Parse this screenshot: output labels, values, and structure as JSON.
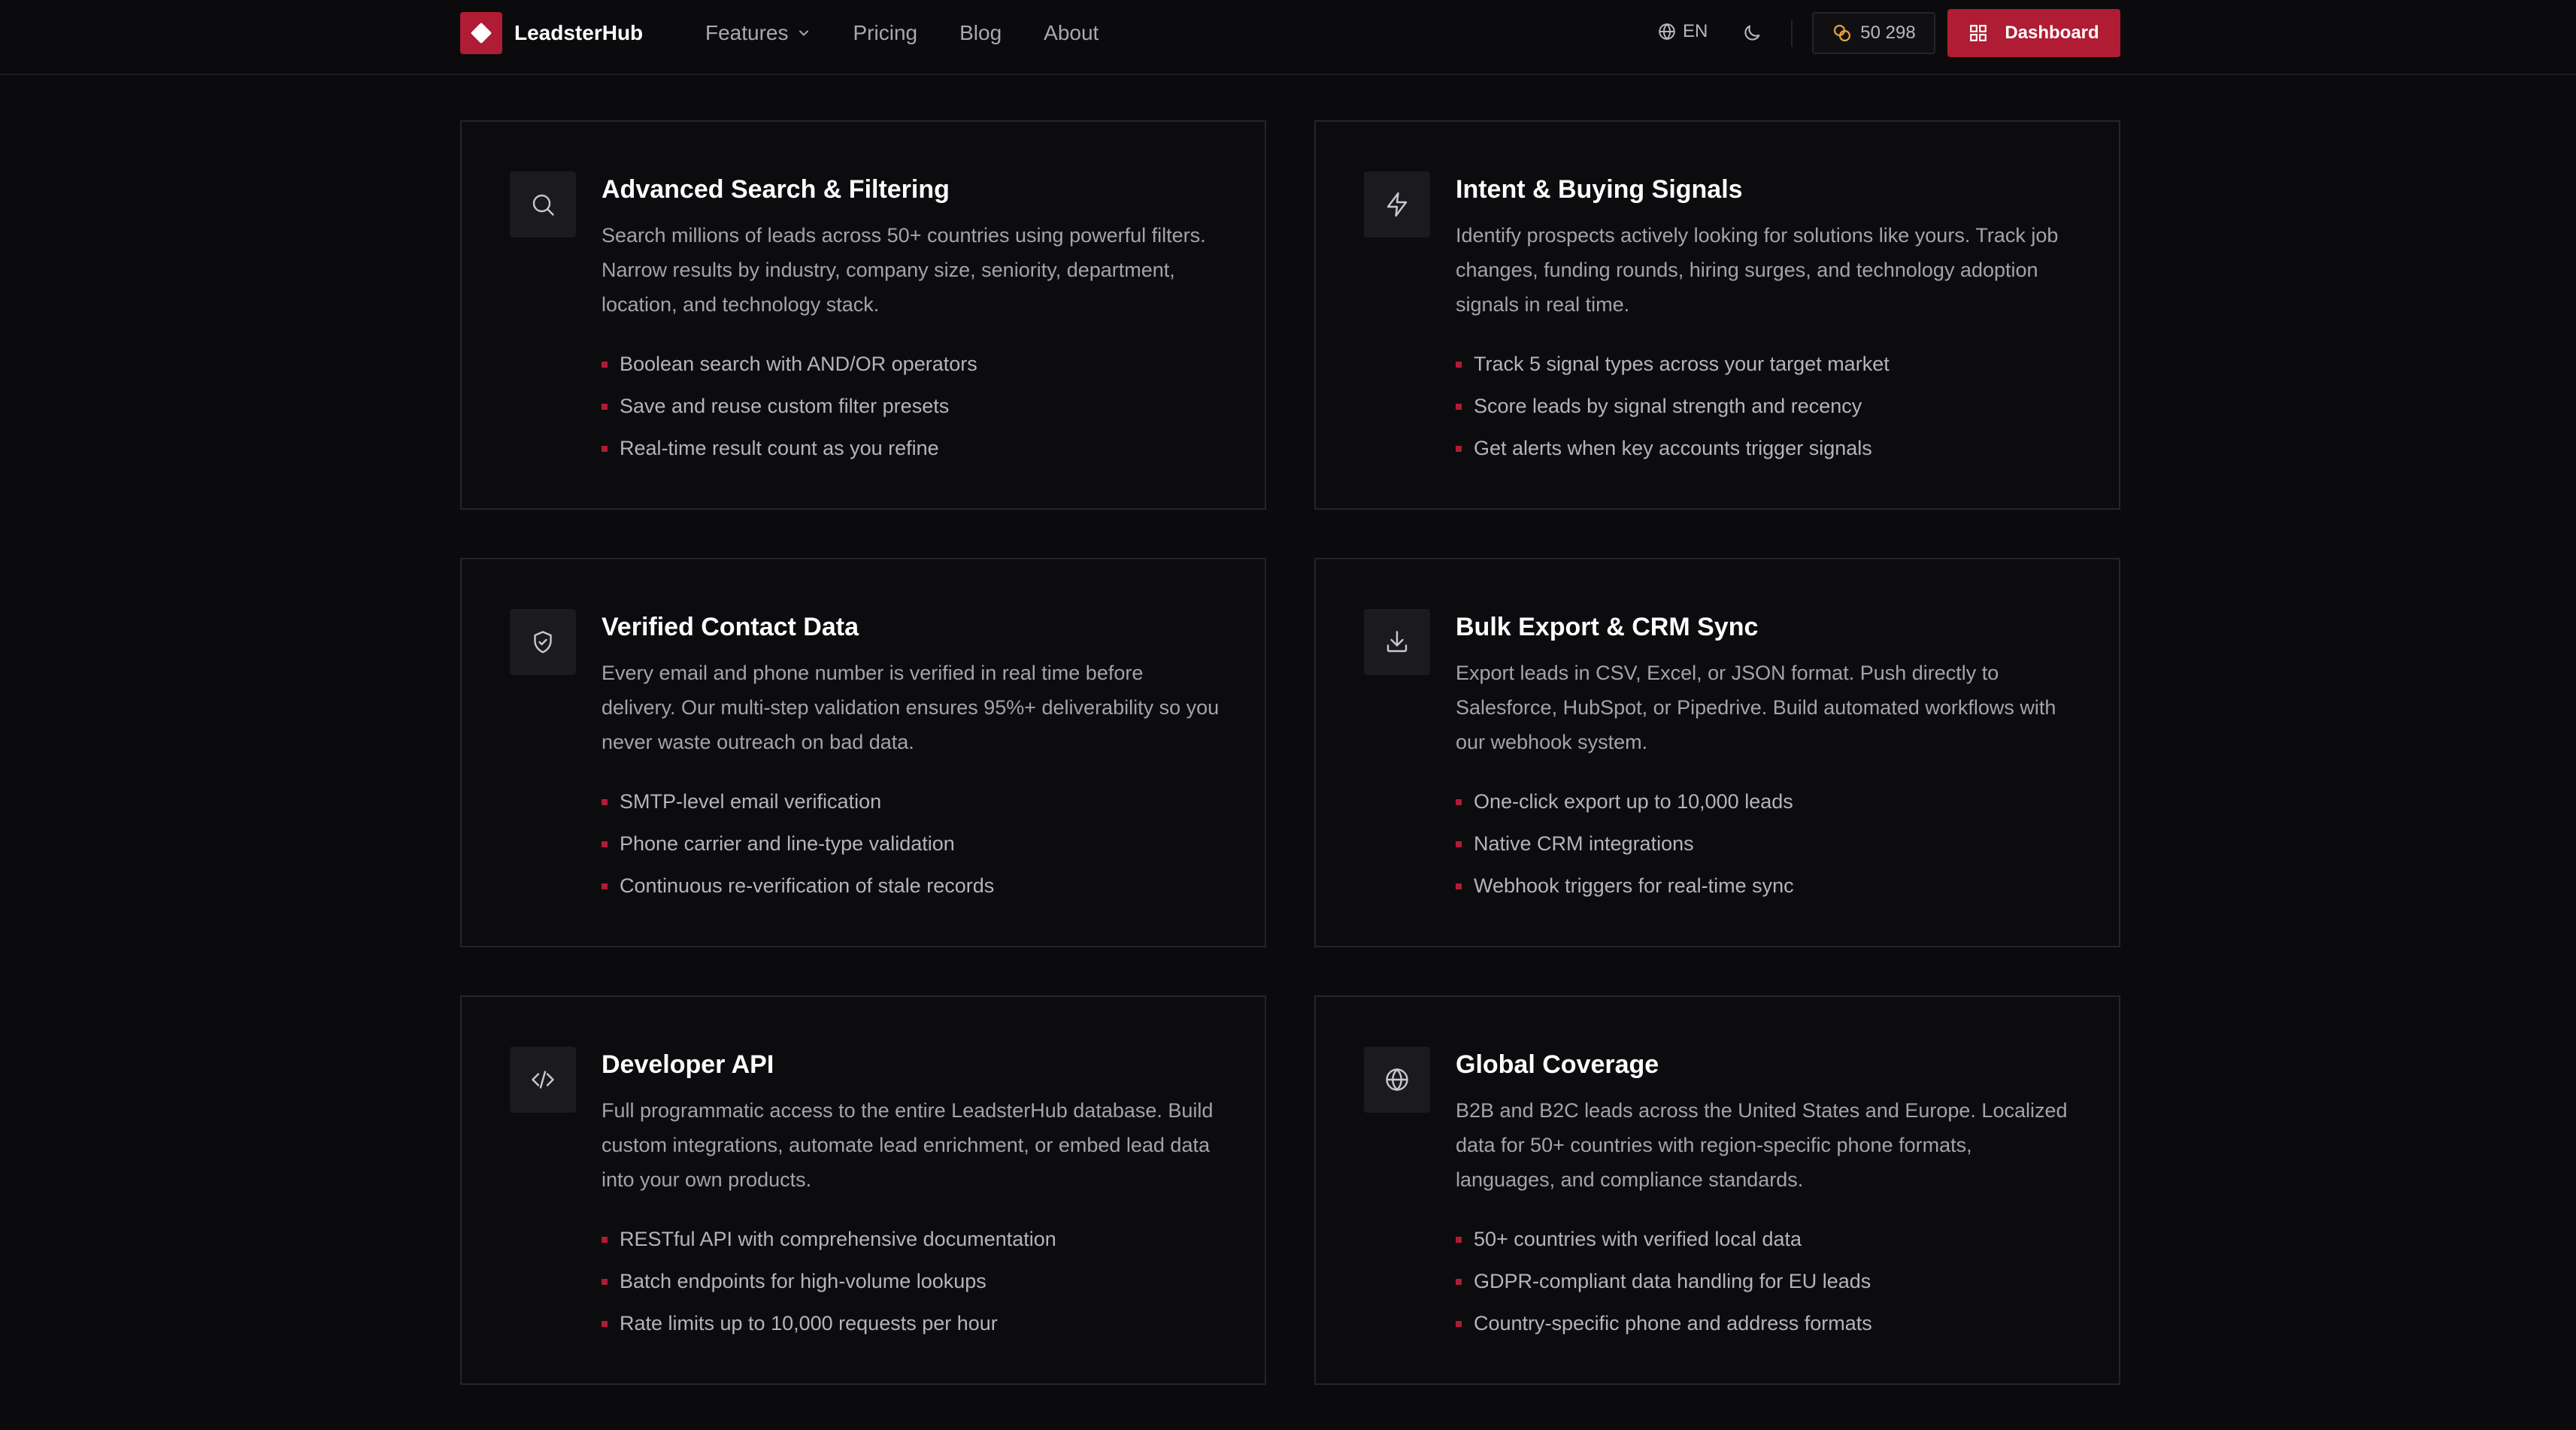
{
  "brand": {
    "name": "LeadsterHub",
    "accent_color": "#b01c33"
  },
  "nav": {
    "items": [
      {
        "label": "Features",
        "has_dropdown": true
      },
      {
        "label": "Pricing"
      },
      {
        "label": "Blog"
      },
      {
        "label": "About"
      }
    ]
  },
  "header": {
    "language": "EN",
    "credits": "50 298",
    "dashboard_label": "Dashboard"
  },
  "features": [
    {
      "icon": "search-icon",
      "title": "Advanced Search & Filtering",
      "description": "Search millions of leads across 50+ countries using powerful filters. Narrow results by industry, company size, seniority, department, location, and technology stack.",
      "bullets": [
        "Boolean search with AND/OR operators",
        "Save and reuse custom filter presets",
        "Real-time result count as you refine"
      ]
    },
    {
      "icon": "lightning-icon",
      "title": "Intent & Buying Signals",
      "description": "Identify prospects actively looking for solutions like yours. Track job changes, funding rounds, hiring surges, and technology adoption signals in real time.",
      "bullets": [
        "Track 5 signal types across your target market",
        "Score leads by signal strength and recency",
        "Get alerts when key accounts trigger signals"
      ]
    },
    {
      "icon": "shield-check-icon",
      "title": "Verified Contact Data",
      "description": "Every email and phone number is verified in real time before delivery. Our multi-step validation ensures 95%+ deliverability so you never waste outreach on bad data.",
      "bullets": [
        "SMTP-level email verification",
        "Phone carrier and line-type validation",
        "Continuous re-verification of stale records"
      ]
    },
    {
      "icon": "download-icon",
      "title": "Bulk Export & CRM Sync",
      "description": "Export leads in CSV, Excel, or JSON format. Push directly to Salesforce, HubSpot, or Pipedrive. Build automated workflows with our webhook system.",
      "bullets": [
        "One-click export up to 10,000 leads",
        "Native CRM integrations",
        "Webhook triggers for real-time sync"
      ]
    },
    {
      "icon": "code-icon",
      "title": "Developer API",
      "description": "Full programmatic access to the entire LeadsterHub database. Build custom integrations, automate lead enrichment, or embed lead data into your own products.",
      "bullets": [
        "RESTful API with comprehensive documentation",
        "Batch endpoints for high-volume lookups",
        "Rate limits up to 10,000 requests per hour"
      ]
    },
    {
      "icon": "globe-icon",
      "title": "Global Coverage",
      "description": "B2B and B2C leads across the United States and Europe. Localized data for 50+ countries with region-specific phone formats, languages, and compliance standards.",
      "bullets": [
        "50+ countries with verified local data",
        "GDPR-compliant data handling for EU leads",
        "Country-specific phone and address formats"
      ]
    }
  ]
}
